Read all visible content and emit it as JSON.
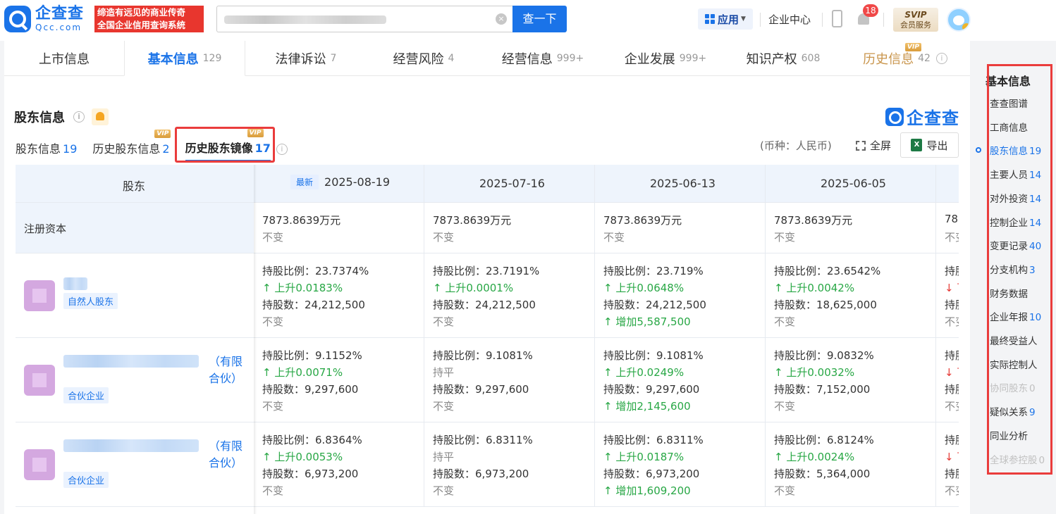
{
  "header": {
    "logo_cn": "企查查",
    "logo_en": "Qcc.com",
    "slogan_line1": "缔造有远见的商业传奇",
    "slogan_line2": "全国企业信用查询系统",
    "search_button": "查一下",
    "app_label": "应用",
    "enterprise_center": "企业中心",
    "notification_count": "18",
    "svip_line1": "SVIP",
    "svip_line2": "会员服务"
  },
  "tabs": [
    {
      "label": "上市信息",
      "count": ""
    },
    {
      "label": "基本信息",
      "count": "129"
    },
    {
      "label": "法律诉讼",
      "count": "7"
    },
    {
      "label": "经营风险",
      "count": "4"
    },
    {
      "label": "经营信息",
      "count": "999+"
    },
    {
      "label": "企业发展",
      "count": "999+"
    },
    {
      "label": "知识产权",
      "count": "608"
    },
    {
      "label": "历史信息",
      "count": "42",
      "vip": "VIP"
    }
  ],
  "section": {
    "title": "股东信息",
    "brand": "企查查",
    "currency": "(币种：人民币)",
    "fullscreen": "全屏",
    "export": "导出"
  },
  "subtabs": [
    {
      "label": "股东信息",
      "count": "19"
    },
    {
      "label": "历史股东信息",
      "count": "2",
      "vip": "VIP"
    },
    {
      "label": "历史股东镜像",
      "count": "17",
      "vip": "VIP"
    }
  ],
  "table": {
    "corner_header": "股东",
    "latest_tag": "最新",
    "dates": [
      "2025-08-19",
      "2025-07-16",
      "2025-06-13",
      "2025-06-05"
    ],
    "capital_label": "注册资本",
    "capital": [
      {
        "value": "7873.8639万元",
        "change": "不变"
      },
      {
        "value": "7873.8639万元",
        "change": "不变"
      },
      {
        "value": "7873.8639万元",
        "change": "不变"
      },
      {
        "value": "7873.8639万元",
        "change": "不变"
      }
    ],
    "capital_partial": {
      "value": "787",
      "change": "不变"
    },
    "shareholders": [
      {
        "name_suffix": "",
        "tag": "自然人股东",
        "cells": [
          {
            "ratio": "持股比例：23.7374%",
            "ratio_change": "上升0.0183%",
            "ratio_dir": "up",
            "shares": "持股数：24,212,500",
            "shares_change": "不变",
            "shares_dir": "none"
          },
          {
            "ratio": "持股比例：23.7191%",
            "ratio_change": "上升0.0001%",
            "ratio_dir": "up",
            "shares": "持股数：24,212,500",
            "shares_change": "不变",
            "shares_dir": "none"
          },
          {
            "ratio": "持股比例：23.719%",
            "ratio_change": "上升0.0648%",
            "ratio_dir": "up",
            "shares": "持股数：24,212,500",
            "shares_change": "增加5,587,500",
            "shares_dir": "up"
          },
          {
            "ratio": "持股比例：23.6542%",
            "ratio_change": "上升0.0042%",
            "ratio_dir": "up",
            "shares": "持股数：18,625,000",
            "shares_change": "不变",
            "shares_dir": "none"
          }
        ],
        "partial": {
          "ratio": "持股",
          "ratio_change": "下",
          "shares": "持股",
          "shares_change": "不变"
        }
      },
      {
        "name_suffix": "（有限合伙）",
        "tag": "合伙企业",
        "cells": [
          {
            "ratio": "持股比例：9.1152%",
            "ratio_change": "上升0.0071%",
            "ratio_dir": "up",
            "shares": "持股数：9,297,600",
            "shares_change": "不变",
            "shares_dir": "none"
          },
          {
            "ratio": "持股比例：9.1081%",
            "ratio_change": "持平",
            "ratio_dir": "none",
            "shares": "持股数：9,297,600",
            "shares_change": "不变",
            "shares_dir": "none"
          },
          {
            "ratio": "持股比例：9.1081%",
            "ratio_change": "上升0.0249%",
            "ratio_dir": "up",
            "shares": "持股数：9,297,600",
            "shares_change": "增加2,145,600",
            "shares_dir": "up"
          },
          {
            "ratio": "持股比例：9.0832%",
            "ratio_change": "上升0.0032%",
            "ratio_dir": "up",
            "shares": "持股数：7,152,000",
            "shares_change": "不变",
            "shares_dir": "none"
          }
        ],
        "partial": {
          "ratio": "持股",
          "ratio_change": "下",
          "shares": "持股",
          "shares_change": "不变"
        }
      },
      {
        "name_suffix": "（有限合伙）",
        "tag": "合伙企业",
        "cells": [
          {
            "ratio": "持股比例：6.8364%",
            "ratio_change": "上升0.0053%",
            "ratio_dir": "up",
            "shares": "持股数：6,973,200",
            "shares_change": "不变",
            "shares_dir": "none"
          },
          {
            "ratio": "持股比例：6.8311%",
            "ratio_change": "持平",
            "ratio_dir": "none",
            "shares": "持股数：6,973,200",
            "shares_change": "不变",
            "shares_dir": "none"
          },
          {
            "ratio": "持股比例：6.8311%",
            "ratio_change": "上升0.0187%",
            "ratio_dir": "up",
            "shares": "持股数：6,973,200",
            "shares_change": "增加1,609,200",
            "shares_dir": "up"
          },
          {
            "ratio": "持股比例：6.8124%",
            "ratio_change": "上升0.0024%",
            "ratio_dir": "up",
            "shares": "持股数：5,364,000",
            "shares_change": "不变",
            "shares_dir": "none"
          }
        ],
        "partial": {
          "ratio": "持股",
          "ratio_change": "下",
          "shares": "持股",
          "shares_change": "不变"
        }
      }
    ]
  },
  "rightnav": {
    "title": "基本信息",
    "items": [
      {
        "label": "查查图谱",
        "count": "",
        "state": "normal"
      },
      {
        "label": "工商信息",
        "count": "",
        "state": "normal"
      },
      {
        "label": "股东信息",
        "count": "19",
        "state": "active"
      },
      {
        "label": "主要人员",
        "count": "14",
        "state": "normal"
      },
      {
        "label": "对外投资",
        "count": "14",
        "state": "normal"
      },
      {
        "label": "控制企业",
        "count": "14",
        "state": "normal"
      },
      {
        "label": "变更记录",
        "count": "40",
        "state": "normal"
      },
      {
        "label": "分支机构",
        "count": "3",
        "state": "normal"
      },
      {
        "label": "财务数据",
        "count": "",
        "state": "normal"
      },
      {
        "label": "企业年报",
        "count": "10",
        "state": "normal"
      },
      {
        "label": "最终受益人",
        "count": "",
        "state": "normal"
      },
      {
        "label": "实际控制人",
        "count": "",
        "state": "normal"
      },
      {
        "label": "协同股东",
        "count": "0",
        "state": "disabled"
      },
      {
        "label": "疑似关系",
        "count": "9",
        "state": "normal"
      },
      {
        "label": "同业分析",
        "count": "",
        "state": "normal"
      },
      {
        "label": "全球参控股",
        "count": "0",
        "state": "disabled"
      }
    ]
  },
  "colors": {
    "brand": "#1a73e8",
    "up": "#28a745",
    "down": "#e53935",
    "highlight": "#ea3c3c"
  }
}
